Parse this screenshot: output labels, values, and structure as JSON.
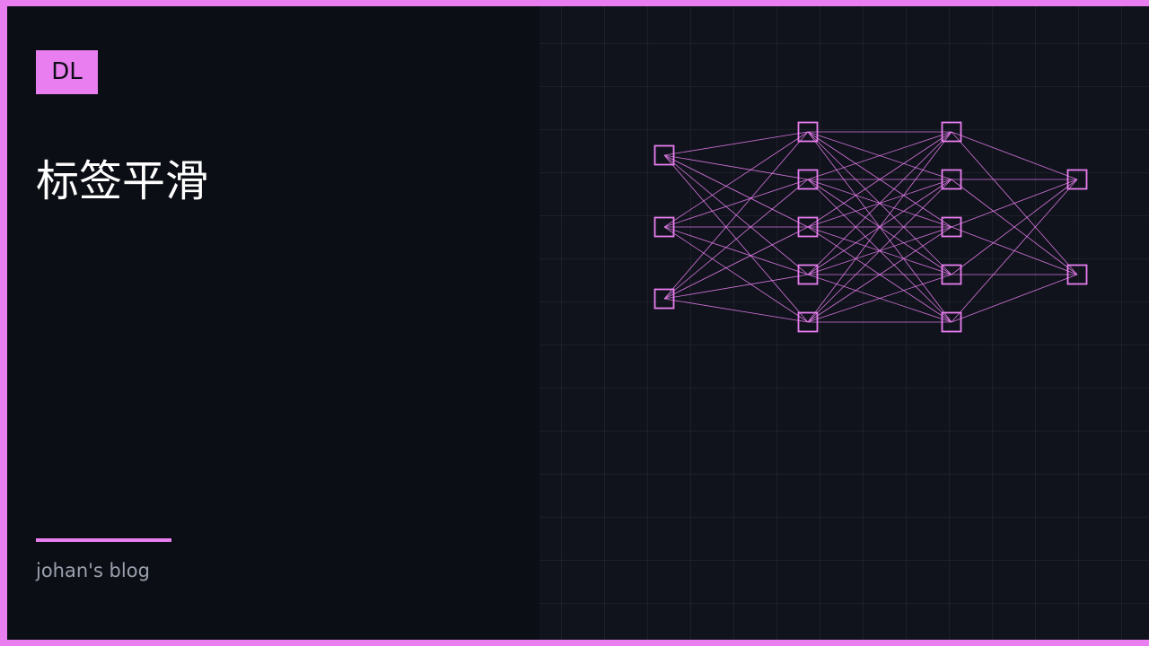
{
  "badge": {
    "text": "DL"
  },
  "title": "标签平滑",
  "author": "johan's blog",
  "colors": {
    "accent": "#e97ef0",
    "background": "#0c0e15",
    "panel": "#10131c",
    "title_text": "#ffffff",
    "author_text": "#9aa0ad"
  },
  "network": {
    "layers": [
      3,
      5,
      5,
      2
    ]
  }
}
